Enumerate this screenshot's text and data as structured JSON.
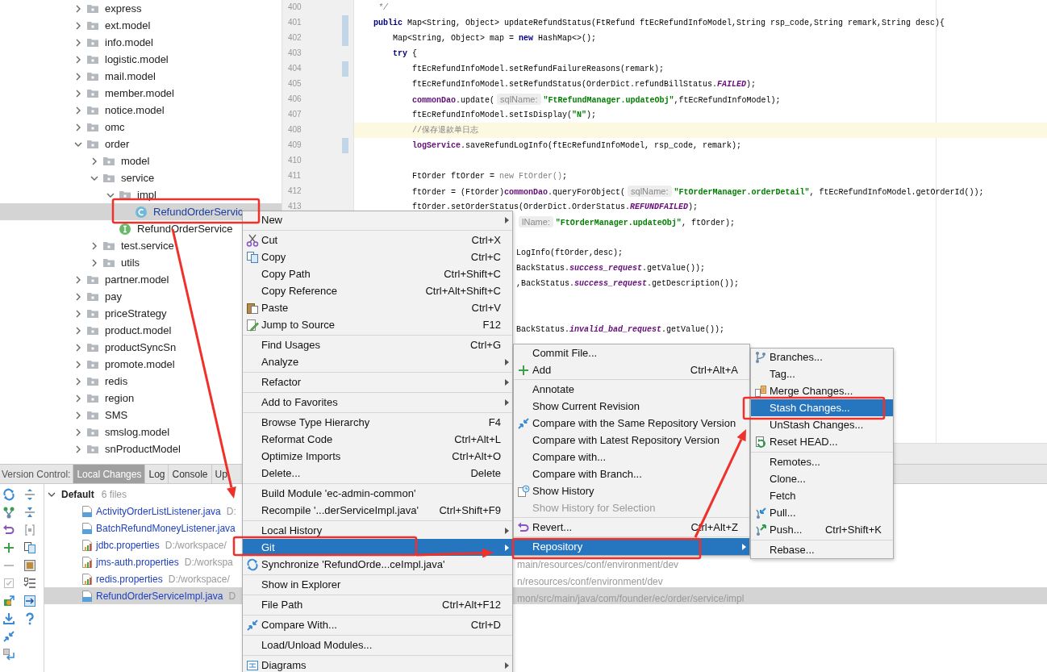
{
  "project_tree": {
    "items": [
      {
        "label": "express",
        "kind": "folder",
        "expanded": false,
        "selected": false
      },
      {
        "label": "ext.model",
        "kind": "folder",
        "expanded": false,
        "selected": false
      },
      {
        "label": "info.model",
        "kind": "folder",
        "expanded": false,
        "selected": false
      },
      {
        "label": "logistic.model",
        "kind": "folder",
        "expanded": false,
        "selected": false
      },
      {
        "label": "mail.model",
        "kind": "folder",
        "expanded": false,
        "selected": false
      },
      {
        "label": "member.model",
        "kind": "folder",
        "expanded": false,
        "selected": false
      },
      {
        "label": "notice.model",
        "kind": "folder",
        "expanded": false,
        "selected": false
      },
      {
        "label": "omc",
        "kind": "folder",
        "expanded": false,
        "selected": false
      },
      {
        "label": "order",
        "kind": "folder",
        "expanded": true,
        "selected": false,
        "children": [
          {
            "label": "model",
            "kind": "folder",
            "expanded": false,
            "selected": false
          },
          {
            "label": "service",
            "kind": "folder",
            "expanded": true,
            "selected": false,
            "children": [
              {
                "label": "impl",
                "kind": "folder",
                "expanded": true,
                "selected": false,
                "children": [
                  {
                    "label": "RefundOrderServic",
                    "kind": "class",
                    "selected": true
                  }
                ]
              },
              {
                "label": "RefundOrderService",
                "kind": "interface",
                "selected": false
              }
            ]
          },
          {
            "label": "test.service",
            "kind": "folder",
            "expanded": false,
            "selected": false
          },
          {
            "label": "utils",
            "kind": "folder",
            "expanded": false,
            "selected": false
          }
        ]
      },
      {
        "label": "partner.model",
        "kind": "folder",
        "expanded": false,
        "selected": false
      },
      {
        "label": "pay",
        "kind": "folder",
        "expanded": false,
        "selected": false
      },
      {
        "label": "priceStrategy",
        "kind": "folder",
        "expanded": false,
        "selected": false
      },
      {
        "label": "product.model",
        "kind": "folder",
        "expanded": false,
        "selected": false
      },
      {
        "label": "productSyncSn",
        "kind": "folder",
        "expanded": false,
        "selected": false
      },
      {
        "label": "promote.model",
        "kind": "folder",
        "expanded": false,
        "selected": false
      },
      {
        "label": "redis",
        "kind": "folder",
        "expanded": false,
        "selected": false
      },
      {
        "label": "region",
        "kind": "folder",
        "expanded": false,
        "selected": false
      },
      {
        "label": "SMS",
        "kind": "folder",
        "expanded": false,
        "selected": false
      },
      {
        "label": "smslog.model",
        "kind": "folder",
        "expanded": false,
        "selected": false
      },
      {
        "label": "snProductModel",
        "kind": "folder",
        "expanded": false,
        "selected": false
      }
    ]
  },
  "editor": {
    "lines": [
      {
        "kind": "line",
        "number": "400",
        "changed": false,
        "current": false,
        "tokens": [
          {
            "kind": "comment",
            "text": "     */"
          }
        ]
      },
      {
        "kind": "line",
        "number": "401",
        "changed": true,
        "current": false,
        "tokens": [
          {
            "kind": "keyword",
            "text": "    public"
          },
          {
            "kind": "plain",
            "text": " Map<String, Object> updateRefundStatus(FtRefund ftEcRefundInfoModel,String rsp_code,String remark,String desc){"
          }
        ]
      },
      {
        "kind": "line",
        "number": "402",
        "changed": true,
        "current": false,
        "tokens": [
          {
            "kind": "plain",
            "text": "        Map<String, Object> map = "
          },
          {
            "kind": "keyword",
            "text": "new"
          },
          {
            "kind": "plain",
            "text": " HashMap<>();"
          }
        ]
      },
      {
        "kind": "line",
        "number": "403",
        "changed": false,
        "current": false,
        "tokens": [
          {
            "kind": "keyword",
            "text": "        try"
          },
          {
            "kind": "plain",
            "text": " {"
          }
        ]
      },
      {
        "kind": "line",
        "number": "404",
        "changed": true,
        "current": false,
        "tokens": [
          {
            "kind": "plain",
            "text": "            ftEcRefundInfoModel.setRefundFailureReasons(remark);"
          }
        ]
      },
      {
        "kind": "line",
        "number": "405",
        "changed": false,
        "current": false,
        "tokens": [
          {
            "kind": "plain",
            "text": "            ftEcRefundInfoModel.setRefundStatus(OrderDict.refundBillStatus."
          },
          {
            "kind": "constant",
            "text": "FAILED"
          },
          {
            "kind": "plain",
            "text": ");"
          }
        ]
      },
      {
        "kind": "line",
        "number": "406",
        "changed": false,
        "current": false,
        "tokens": [
          {
            "kind": "field",
            "text": "            commonDao"
          },
          {
            "kind": "plain",
            "text": ".update("
          },
          {
            "kind": "hint",
            "text": "sqlName:"
          },
          {
            "kind": "string",
            "text": "\"FtRefundManager.updateObj\""
          },
          {
            "kind": "plain",
            "text": ",ftEcRefundInfoModel);"
          }
        ]
      },
      {
        "kind": "line",
        "number": "407",
        "changed": false,
        "current": false,
        "tokens": [
          {
            "kind": "plain",
            "text": "            ftEcRefundInfoModel.setIsDisplay("
          },
          {
            "kind": "string",
            "text": "\"N\""
          },
          {
            "kind": "plain",
            "text": ");"
          }
        ]
      },
      {
        "kind": "line",
        "number": "408",
        "changed": false,
        "current": true,
        "tokens": [
          {
            "kind": "comment",
            "text": "            //保存退款单日志"
          }
        ]
      },
      {
        "kind": "line",
        "number": "409",
        "changed": true,
        "current": false,
        "tokens": [
          {
            "kind": "field",
            "text": "            logService"
          },
          {
            "kind": "plain",
            "text": ".saveRefundLogInfo(ftEcRefundInfoModel, rsp_code, remark);"
          }
        ]
      },
      {
        "kind": "line",
        "number": "410",
        "changed": false,
        "current": false
      },
      {
        "kind": "line",
        "number": "411",
        "changed": false,
        "current": false,
        "tokens": [
          {
            "kind": "plain",
            "text": "            FtOrder ftOrder = "
          },
          {
            "kind": "unused",
            "text": "new FtOrder()"
          },
          {
            "kind": "plain",
            "text": ";"
          }
        ]
      },
      {
        "kind": "line",
        "number": "412",
        "changed": false,
        "current": false,
        "tokens": [
          {
            "kind": "plain",
            "text": "            ftOrder = (FtOrder)"
          },
          {
            "kind": "field",
            "text": "commonDao"
          },
          {
            "kind": "plain",
            "text": ".queryForObject("
          },
          {
            "kind": "hint",
            "text": "sqlName:"
          },
          {
            "kind": "string",
            "text": "\"FtOrderManager.orderDetail\""
          },
          {
            "kind": "plain",
            "text": ", ftEcRefundInfoModel.getOrderId());"
          }
        ]
      },
      {
        "kind": "line",
        "number": "413",
        "changed": false,
        "current": false,
        "tokens": [
          {
            "kind": "plain",
            "text": "            ftOrder.setOrderStatus(OrderDict.OrderStatus."
          },
          {
            "kind": "constant",
            "text": "REFUNDFAILED"
          },
          {
            "kind": "plain",
            "text": ");"
          }
        ]
      },
      {
        "kind": "fragment",
        "tokens": [
          {
            "kind": "hint",
            "text": "lName:"
          },
          {
            "kind": "string",
            "text": "\"FtOrderManager.updateObj\""
          },
          {
            "kind": "plain",
            "text": ", ftOrder);"
          }
        ]
      },
      {
        "kind": "fragment"
      },
      {
        "kind": "fragment",
        "tokens": [
          {
            "kind": "plain",
            "text": "LogInfo(ftOrder,desc);"
          }
        ]
      },
      {
        "kind": "fragment",
        "tokens": [
          {
            "kind": "plain",
            "text": "BackStatus."
          },
          {
            "kind": "constant",
            "text": "success_request"
          },
          {
            "kind": "plain",
            "text": ".getValue());"
          }
        ]
      },
      {
        "kind": "fragment",
        "tokens": [
          {
            "kind": "plain",
            "text": ",BackStatus."
          },
          {
            "kind": "constant",
            "text": "success_request"
          },
          {
            "kind": "plain",
            "text": ".getDescription());"
          }
        ]
      },
      {
        "kind": "fragment"
      },
      {
        "kind": "fragment"
      },
      {
        "kind": "fragment",
        "tokens": [
          {
            "kind": "plain",
            "text": "BackStatus."
          },
          {
            "kind": "constant",
            "text": "invalid_bad_request"
          },
          {
            "kind": "plain",
            "text": ".getValue());"
          }
        ]
      }
    ]
  },
  "version_control": {
    "label": "Version Control:",
    "tabs": [
      {
        "label": "Local Changes",
        "selected": true
      },
      {
        "label": "Log",
        "selected": false
      },
      {
        "label": "Console",
        "selected": false
      },
      {
        "label": "Up",
        "selected": false
      }
    ],
    "changelist": {
      "name": "Default",
      "count": "6 files",
      "expanded": true,
      "files": [
        {
          "kind": "java",
          "name": "ActivityOrderListListener.java",
          "path": "D:",
          "selected": false
        },
        {
          "kind": "java",
          "name": "BatchRefundMoneyListener.java",
          "selected": false
        },
        {
          "kind": "properties",
          "name": "jdbc.properties",
          "path": "D:/workspace/",
          "selected": false
        },
        {
          "kind": "properties",
          "name": "jms-auth.properties",
          "path": "D:/workspa",
          "path_end": "main/resources/conf/environment/dev",
          "selected": false
        },
        {
          "kind": "properties",
          "name": "redis.properties",
          "path": "D:/workspace/",
          "path_end": "n/resources/conf/environment/dev",
          "selected": false
        },
        {
          "kind": "java",
          "name": "RefundOrderServiceImpl.java",
          "path": "D",
          "path_end": "mon/src/main/java/com/founder/ec/order/service/impl",
          "selected": true
        }
      ]
    }
  },
  "context_menu": {
    "items": [
      {
        "kind": "item",
        "label": "New",
        "submenu": true,
        "selected": false
      },
      {
        "kind": "separator"
      },
      {
        "kind": "item",
        "label": "Cut",
        "shortcut": "Ctrl+X",
        "selected": false
      },
      {
        "kind": "item",
        "label": "Copy",
        "shortcut": "Ctrl+C",
        "selected": false
      },
      {
        "kind": "item",
        "label": "Copy Path",
        "shortcut": "Ctrl+Shift+C",
        "selected": false
      },
      {
        "kind": "item",
        "label": "Copy Reference",
        "shortcut": "Ctrl+Alt+Shift+C",
        "selected": false
      },
      {
        "kind": "item",
        "label": "Paste",
        "shortcut": "Ctrl+V",
        "selected": false
      },
      {
        "kind": "item",
        "label": "Jump to Source",
        "shortcut": "F12",
        "selected": false
      },
      {
        "kind": "separator"
      },
      {
        "kind": "item",
        "label": "Find Usages",
        "shortcut": "Ctrl+G",
        "selected": false
      },
      {
        "kind": "item",
        "label": "Analyze",
        "submenu": true,
        "selected": false
      },
      {
        "kind": "separator"
      },
      {
        "kind": "item",
        "label": "Refactor",
        "submenu": true,
        "selected": false
      },
      {
        "kind": "separator"
      },
      {
        "kind": "item",
        "label": "Add to Favorites",
        "submenu": true,
        "selected": false
      },
      {
        "kind": "separator"
      },
      {
        "kind": "item",
        "label": "Browse Type Hierarchy",
        "shortcut": "F4",
        "selected": false
      },
      {
        "kind": "item",
        "label": "Reformat Code",
        "shortcut": "Ctrl+Alt+L",
        "selected": false
      },
      {
        "kind": "item",
        "label": "Optimize Imports",
        "shortcut": "Ctrl+Alt+O",
        "selected": false
      },
      {
        "kind": "item",
        "label": "Delete...",
        "shortcut": "Delete",
        "selected": false
      },
      {
        "kind": "separator"
      },
      {
        "kind": "item",
        "label": "Build Module 'ec-admin-common'",
        "selected": false
      },
      {
        "kind": "item",
        "label": "Recompile '...derServiceImpl.java'",
        "shortcut": "Ctrl+Shift+F9",
        "selected": false
      },
      {
        "kind": "separator"
      },
      {
        "kind": "item",
        "label": "Local History",
        "submenu": true,
        "selected": false
      },
      {
        "kind": "item",
        "label": "Git",
        "submenu": true,
        "selected": true
      },
      {
        "kind": "item",
        "label": "Synchronize 'RefundOrde...ceImpl.java'",
        "selected": false
      },
      {
        "kind": "separator"
      },
      {
        "kind": "item",
        "label": "Show in Explorer",
        "selected": false
      },
      {
        "kind": "separator"
      },
      {
        "kind": "item",
        "label": "File Path",
        "shortcut": "Ctrl+Alt+F12",
        "selected": false
      },
      {
        "kind": "separator"
      },
      {
        "kind": "item",
        "label": "Compare With...",
        "shortcut": "Ctrl+D",
        "selected": false
      },
      {
        "kind": "separator"
      },
      {
        "kind": "item",
        "label": "Load/Unload Modules...",
        "selected": false
      },
      {
        "kind": "separator"
      },
      {
        "kind": "item",
        "label": "Diagrams",
        "submenu": true,
        "selected": false
      }
    ]
  },
  "git_menu": {
    "items": [
      {
        "kind": "item",
        "label": "Commit File...",
        "selected": false,
        "disabled": false
      },
      {
        "kind": "item",
        "label": "Add",
        "shortcut": "Ctrl+Alt+A",
        "selected": false,
        "disabled": false
      },
      {
        "kind": "separator"
      },
      {
        "kind": "item",
        "label": "Annotate",
        "selected": false,
        "disabled": false
      },
      {
        "kind": "item",
        "label": "Show Current Revision",
        "selected": false,
        "disabled": false
      },
      {
        "kind": "item",
        "label": "Compare with the Same Repository Version",
        "selected": false,
        "disabled": false
      },
      {
        "kind": "item",
        "label": "Compare with Latest Repository Version",
        "selected": false,
        "disabled": false
      },
      {
        "kind": "item",
        "label": "Compare with...",
        "selected": false,
        "disabled": false
      },
      {
        "kind": "item",
        "label": "Compare with Branch...",
        "selected": false,
        "disabled": false
      },
      {
        "kind": "item",
        "label": "Show History",
        "selected": false,
        "disabled": false
      },
      {
        "kind": "item",
        "label": "Show History for Selection",
        "selected": false,
        "disabled": true
      },
      {
        "kind": "separator"
      },
      {
        "kind": "item",
        "label": "Revert...",
        "shortcut": "Ctrl+Alt+Z",
        "selected": false,
        "disabled": false
      },
      {
        "kind": "separator"
      },
      {
        "kind": "item",
        "label": "Repository",
        "submenu": true,
        "selected": true,
        "disabled": false
      }
    ]
  },
  "repository_menu": {
    "items": [
      {
        "kind": "item",
        "label": "Branches...",
        "selected": false
      },
      {
        "kind": "item",
        "label": "Tag...",
        "selected": false
      },
      {
        "kind": "item",
        "label": "Merge Changes...",
        "selected": false
      },
      {
        "kind": "item",
        "label": "Stash Changes...",
        "selected": true
      },
      {
        "kind": "item",
        "label": "UnStash Changes...",
        "selected": false
      },
      {
        "kind": "item",
        "label": "Reset HEAD...",
        "selected": false
      },
      {
        "kind": "separator"
      },
      {
        "kind": "item",
        "label": "Remotes...",
        "selected": false
      },
      {
        "kind": "item",
        "label": "Clone...",
        "selected": false
      },
      {
        "kind": "item",
        "label": "Fetch",
        "selected": false
      },
      {
        "kind": "item",
        "label": "Pull...",
        "selected": false
      },
      {
        "kind": "item",
        "label": "Push...",
        "shortcut": "Ctrl+Shift+K",
        "selected": false
      },
      {
        "kind": "separator"
      },
      {
        "kind": "item",
        "label": "Rebase...",
        "selected": false
      }
    ]
  }
}
